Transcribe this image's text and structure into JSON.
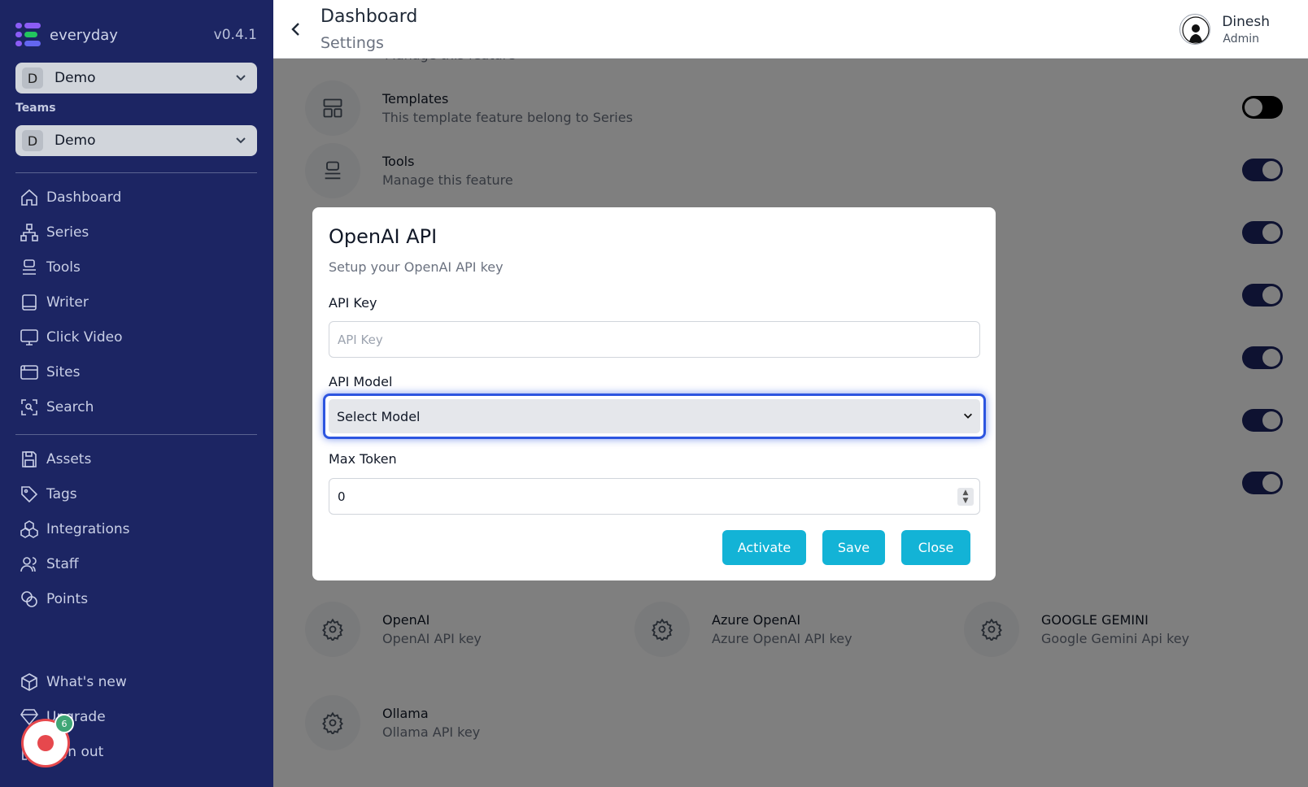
{
  "sidebar": {
    "brand_name": "everyday",
    "version": "v0.4.1",
    "workspace": {
      "badge": "D",
      "label": "Demo"
    },
    "teams_label": "Teams",
    "team": {
      "badge": "D",
      "label": "Demo"
    },
    "nav_primary": [
      {
        "label": "Dashboard",
        "icon": "home-icon"
      },
      {
        "label": "Series",
        "icon": "hierarchy-icon"
      },
      {
        "label": "Tools",
        "icon": "stack-icon"
      },
      {
        "label": "Writer",
        "icon": "book-icon"
      },
      {
        "label": "Click Video",
        "icon": "monitor-icon"
      },
      {
        "label": "Sites",
        "icon": "browser-icon"
      },
      {
        "label": "Search",
        "icon": "scan-search-icon"
      }
    ],
    "nav_secondary": [
      {
        "label": "Assets",
        "icon": "save-icon"
      },
      {
        "label": "Tags",
        "icon": "tag-icon"
      },
      {
        "label": "Integrations",
        "icon": "cubes-icon"
      },
      {
        "label": "Staff",
        "icon": "users-icon"
      },
      {
        "label": "Points",
        "icon": "coins-icon"
      }
    ],
    "nav_bottom": [
      {
        "label": "What's new",
        "icon": "package-icon"
      },
      {
        "label": "Upgrade",
        "icon": "diamond-icon"
      },
      {
        "label": "Sign out",
        "icon": "logout-icon"
      }
    ],
    "record_count": "6"
  },
  "header": {
    "title": "Dashboard",
    "subtitle": "Settings",
    "user_name": "Dinesh",
    "user_role": "Admin"
  },
  "features": {
    "partial_desc": "Manage this feature",
    "templates": {
      "title": "Templates",
      "desc": "This template feature belong to Series",
      "enabled": false
    },
    "tools": {
      "title": "Tools",
      "desc": "Manage this feature",
      "enabled": true
    }
  },
  "integrations": [
    {
      "title": "OpenAI",
      "desc": "OpenAI API key"
    },
    {
      "title": "Azure OpenAI",
      "desc": "Azure OpenAI API key"
    },
    {
      "title": "GOOGLE GEMINI",
      "desc": "Google Gemini Api key"
    },
    {
      "title": "Ollama",
      "desc": "Ollama API key"
    }
  ],
  "modal": {
    "title": "OpenAI API",
    "subtitle": "Setup your OpenAI API key",
    "api_key_label": "API Key",
    "api_key_placeholder": "API Key",
    "api_key_value": "",
    "api_model_label": "API Model",
    "api_model_selected": "Select Model",
    "max_token_label": "Max Token",
    "max_token_value": "0",
    "activate_label": "Activate",
    "save_label": "Save",
    "close_label": "Close"
  },
  "colors": {
    "sidebar_bg": "#1c2563",
    "accent_button": "#13b3d6",
    "focus_ring": "#2d55e0",
    "toggle_on": "#1c2563",
    "record_red": "#e6484d",
    "badge_green": "#3fa676"
  }
}
